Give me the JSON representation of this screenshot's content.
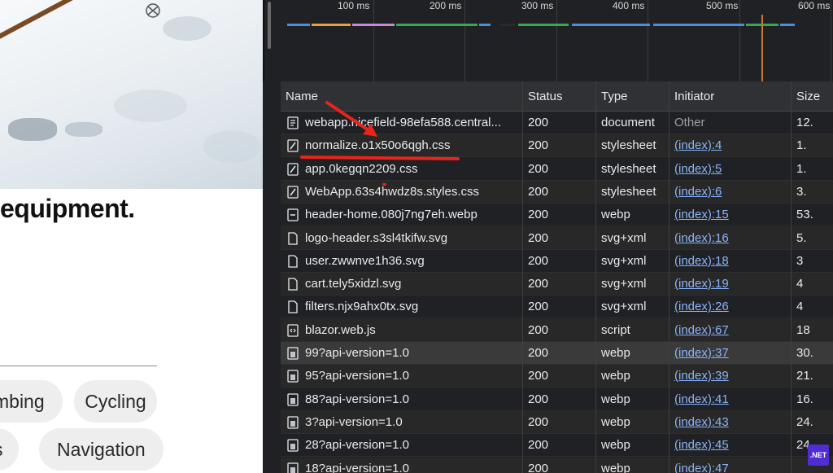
{
  "page": {
    "headline": "equipment.",
    "chips": [
      "mbing",
      "Cycling",
      "s",
      "Navigation"
    ]
  },
  "overview": {
    "ticks": [
      "100 ms",
      "200 ms",
      "300 ms",
      "400 ms",
      "500 ms",
      "600 ms"
    ]
  },
  "table": {
    "headers": {
      "name": "Name",
      "status": "Status",
      "type": "Type",
      "initiator": "Initiator",
      "size": "Size"
    },
    "rows": [
      {
        "name": "webapp.nicefield-98efa588.central...",
        "status": "200",
        "type": "document",
        "initiator": "Other",
        "size": "12.",
        "icon": "document-icon"
      },
      {
        "name": "normalize.o1x50o6qgh.css",
        "status": "200",
        "type": "stylesheet",
        "initiator": "(index):4",
        "size": "1.",
        "icon": "stylesheet-icon"
      },
      {
        "name": "app.0kegqn2209.css",
        "status": "200",
        "type": "stylesheet",
        "initiator": "(index):5",
        "size": "1.",
        "icon": "stylesheet-icon"
      },
      {
        "name": "WebApp.63s4hwdz8s.styles.css",
        "status": "200",
        "type": "stylesheet",
        "initiator": "(index):6",
        "size": "3.",
        "icon": "stylesheet-icon"
      },
      {
        "name": "header-home.080j7ng7eh.webp",
        "status": "200",
        "type": "webp",
        "initiator": "(index):15",
        "size": "53.",
        "icon": "image-file-icon"
      },
      {
        "name": "logo-header.s3sl4tkifw.svg",
        "status": "200",
        "type": "svg+xml",
        "initiator": "(index):16",
        "size": "5.",
        "icon": "file-icon"
      },
      {
        "name": "user.zwwnve1h36.svg",
        "status": "200",
        "type": "svg+xml",
        "initiator": "(index):18",
        "size": "3",
        "icon": "file-icon"
      },
      {
        "name": "cart.tely5xidzl.svg",
        "status": "200",
        "type": "svg+xml",
        "initiator": "(index):19",
        "size": "4",
        "icon": "file-icon"
      },
      {
        "name": "filters.njx9ahx0tx.svg",
        "status": "200",
        "type": "svg+xml",
        "initiator": "(index):26",
        "size": "4",
        "icon": "file-icon"
      },
      {
        "name": "blazor.web.js",
        "status": "200",
        "type": "script",
        "initiator": "(index):67",
        "size": "18",
        "icon": "script-icon"
      },
      {
        "name": "99?api-version=1.0",
        "status": "200",
        "type": "webp",
        "initiator": "(index):37",
        "size": "30.",
        "icon": "image-thumb-icon"
      },
      {
        "name": "95?api-version=1.0",
        "status": "200",
        "type": "webp",
        "initiator": "(index):39",
        "size": "21.",
        "icon": "image-thumb-icon"
      },
      {
        "name": "88?api-version=1.0",
        "status": "200",
        "type": "webp",
        "initiator": "(index):41",
        "size": "16.",
        "icon": "image-thumb-icon"
      },
      {
        "name": "3?api-version=1.0",
        "status": "200",
        "type": "webp",
        "initiator": "(index):43",
        "size": "24.",
        "icon": "image-thumb-icon"
      },
      {
        "name": "28?api-version=1.0",
        "status": "200",
        "type": "webp",
        "initiator": "(index):45",
        "size": "24.",
        "icon": "image-thumb-icon"
      },
      {
        "name": "18?api-version=1.0",
        "status": "200",
        "type": "webp",
        "initiator": "(index):47",
        "size": "",
        "icon": "image-thumb-icon"
      }
    ]
  },
  "badge": {
    "label": ".NET"
  },
  "colors": {
    "link": "#8ab4f8",
    "annotation": "#e8241c",
    "dotnet": "#512bd4"
  }
}
